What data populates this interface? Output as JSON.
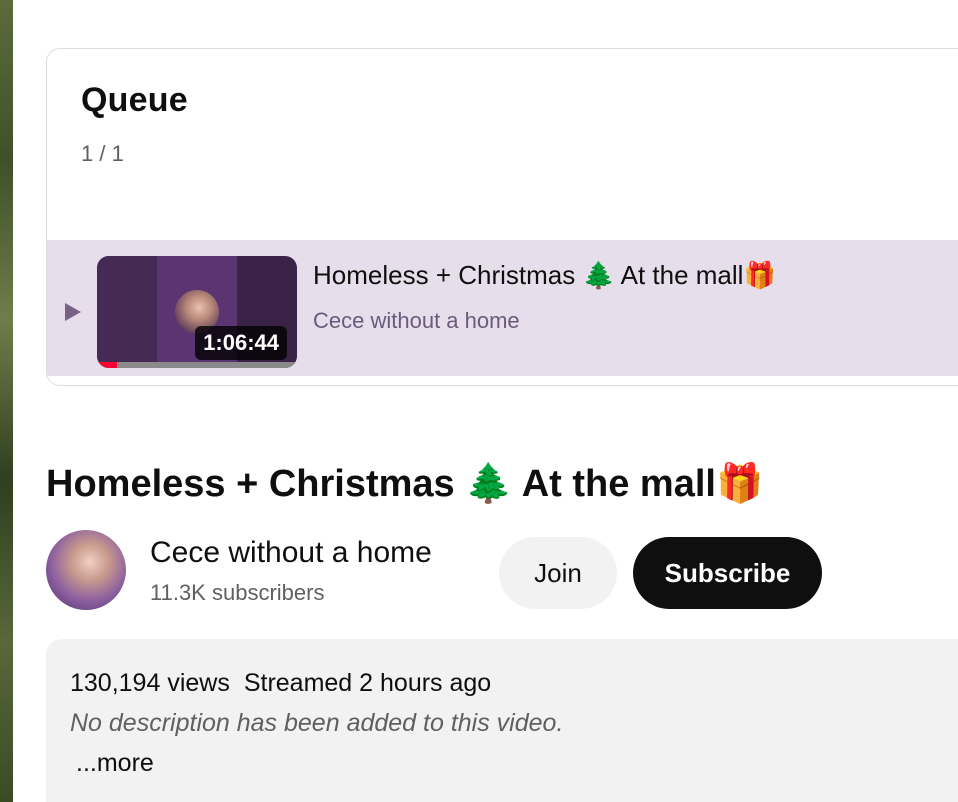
{
  "queue": {
    "title": "Queue",
    "count": "1 / 1",
    "items": [
      {
        "title": "Homeless + Christmas 🌲 At the mall🎁",
        "channel": "Cece without a home",
        "duration": "1:06:44",
        "watched_fraction": 0.1
      }
    ]
  },
  "video": {
    "title": "Homeless + Christmas 🌲 At the mall🎁",
    "channel_name": "Cece without a home",
    "subscribers": "11.3K subscribers",
    "join_label": "Join",
    "subscribe_label": "Subscribe"
  },
  "description": {
    "views": "130,194 views",
    "streamed": "Streamed 2 hours ago",
    "text": "No description has been added to this video.",
    "more_label": "...more"
  },
  "colors": {
    "queue_item_bg": "#e6dfeb",
    "progress": "#ff0033",
    "subscribe_bg": "#0f0f0f"
  },
  "icons": {
    "play_indicator": "play-triangle-icon"
  }
}
